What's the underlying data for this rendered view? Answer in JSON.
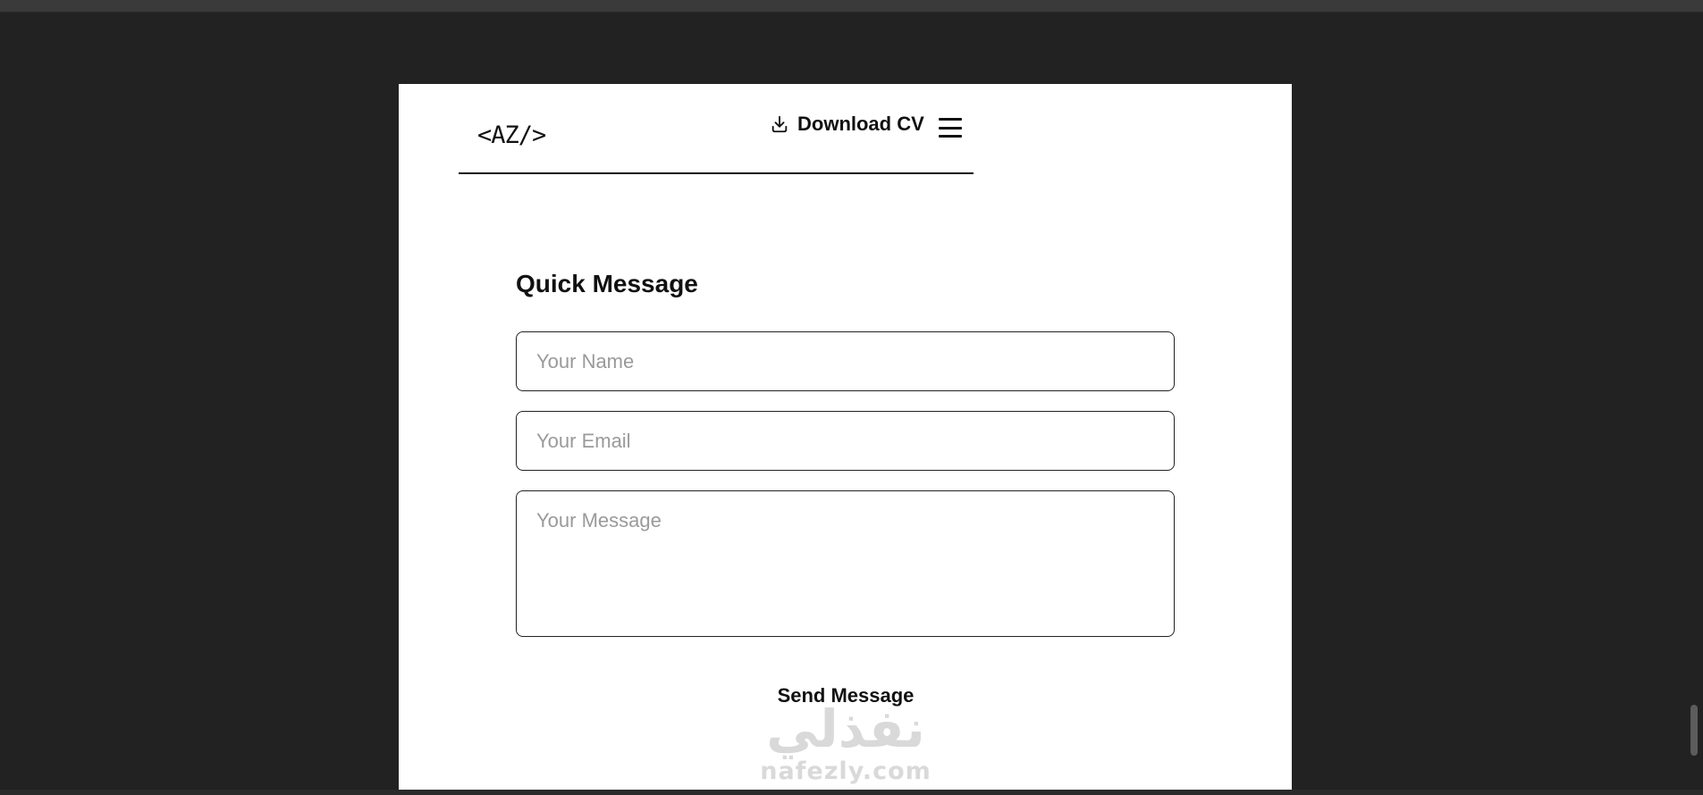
{
  "header": {
    "logo_text": "<AZ/>",
    "download_label": "Download CV",
    "download_icon": "download-icon",
    "menu_icon": "hamburger-menu-icon"
  },
  "contact_form": {
    "title": "Quick Message",
    "name_placeholder": "Your Name",
    "name_value": "",
    "email_placeholder": "Your Email",
    "email_value": "",
    "message_placeholder": "Your Message",
    "message_value": "",
    "submit_label": "Send Message"
  },
  "watermark": {
    "arabic_text": "نفذلي",
    "latin_text": "nafezly.com"
  },
  "colors": {
    "page_background": "#222222",
    "card_background": "#ffffff",
    "text": "#111111",
    "placeholder": "#9a9a9a",
    "watermark": "#d9d9d9"
  }
}
